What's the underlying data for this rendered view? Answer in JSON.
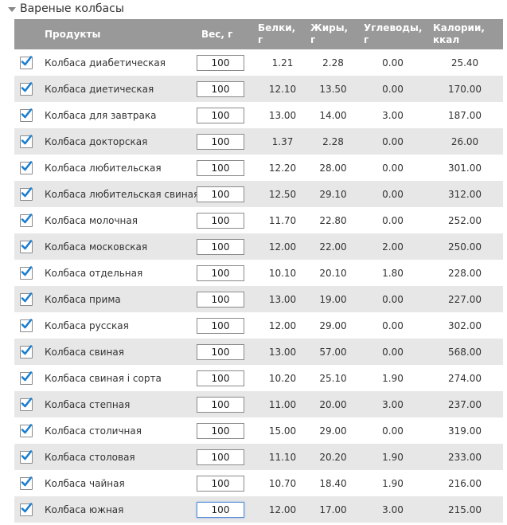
{
  "section": {
    "title": "Вареные колбасы"
  },
  "columns": {
    "product": "Продукты",
    "weight": "Вес, г",
    "protein": [
      "Белки,",
      "г"
    ],
    "fat": [
      "Жиры,",
      "г"
    ],
    "carbs": [
      "Углеводы,",
      "г"
    ],
    "calories": [
      "Калории,",
      "ккал"
    ]
  },
  "colors": {
    "header_bg": "#999999",
    "row_alt": "#e7e7e7",
    "check": "#1a7fd1"
  },
  "rows": [
    {
      "name": "Колбаса диабетическая",
      "weight": "100",
      "protein": "1.21",
      "fat": "2.28",
      "carbs": "0.00",
      "calories": "25.40",
      "checked": true
    },
    {
      "name": "Колбаса диетическая",
      "weight": "100",
      "protein": "12.10",
      "fat": "13.50",
      "carbs": "0.00",
      "calories": "170.00",
      "checked": true
    },
    {
      "name": "Колбаса для завтрака",
      "weight": "100",
      "protein": "13.00",
      "fat": "14.00",
      "carbs": "3.00",
      "calories": "187.00",
      "checked": true
    },
    {
      "name": "Колбаса докторская",
      "weight": "100",
      "protein": "1.37",
      "fat": "2.28",
      "carbs": "0.00",
      "calories": "26.00",
      "checked": true
    },
    {
      "name": "Колбаса любительская",
      "weight": "100",
      "protein": "12.20",
      "fat": "28.00",
      "carbs": "0.00",
      "calories": "301.00",
      "checked": true
    },
    {
      "name": "Колбаса любительская свиная",
      "weight": "100",
      "protein": "12.50",
      "fat": "29.10",
      "carbs": "0.00",
      "calories": "312.00",
      "checked": true
    },
    {
      "name": "Колбаса молочная",
      "weight": "100",
      "protein": "11.70",
      "fat": "22.80",
      "carbs": "0.00",
      "calories": "252.00",
      "checked": true
    },
    {
      "name": "Колбаса московская",
      "weight": "100",
      "protein": "12.00",
      "fat": "22.00",
      "carbs": "2.00",
      "calories": "250.00",
      "checked": true
    },
    {
      "name": "Колбаса отдельная",
      "weight": "100",
      "protein": "10.10",
      "fat": "20.10",
      "carbs": "1.80",
      "calories": "228.00",
      "checked": true
    },
    {
      "name": "Колбаса прима",
      "weight": "100",
      "protein": "13.00",
      "fat": "19.00",
      "carbs": "0.00",
      "calories": "227.00",
      "checked": true
    },
    {
      "name": "Колбаса русская",
      "weight": "100",
      "protein": "12.00",
      "fat": "29.00",
      "carbs": "0.00",
      "calories": "302.00",
      "checked": true
    },
    {
      "name": "Колбаса свиная",
      "weight": "100",
      "protein": "13.00",
      "fat": "57.00",
      "carbs": "0.00",
      "calories": "568.00",
      "checked": true
    },
    {
      "name": "Колбаса свиная i сорта",
      "weight": "100",
      "protein": "10.20",
      "fat": "25.10",
      "carbs": "1.90",
      "calories": "274.00",
      "checked": true
    },
    {
      "name": "Колбаса степная",
      "weight": "100",
      "protein": "11.00",
      "fat": "20.00",
      "carbs": "3.00",
      "calories": "237.00",
      "checked": true
    },
    {
      "name": "Колбаса столичная",
      "weight": "100",
      "protein": "15.00",
      "fat": "29.00",
      "carbs": "0.00",
      "calories": "319.00",
      "checked": true
    },
    {
      "name": "Колбаса столовая",
      "weight": "100",
      "protein": "11.10",
      "fat": "20.20",
      "carbs": "1.90",
      "calories": "233.00",
      "checked": true
    },
    {
      "name": "Колбаса чайная",
      "weight": "100",
      "protein": "10.70",
      "fat": "18.40",
      "carbs": "1.90",
      "calories": "216.00",
      "checked": true
    },
    {
      "name": "Колбаса южная",
      "weight": "100",
      "protein": "12.00",
      "fat": "17.00",
      "carbs": "3.00",
      "calories": "215.00",
      "checked": true,
      "focused": true
    }
  ]
}
